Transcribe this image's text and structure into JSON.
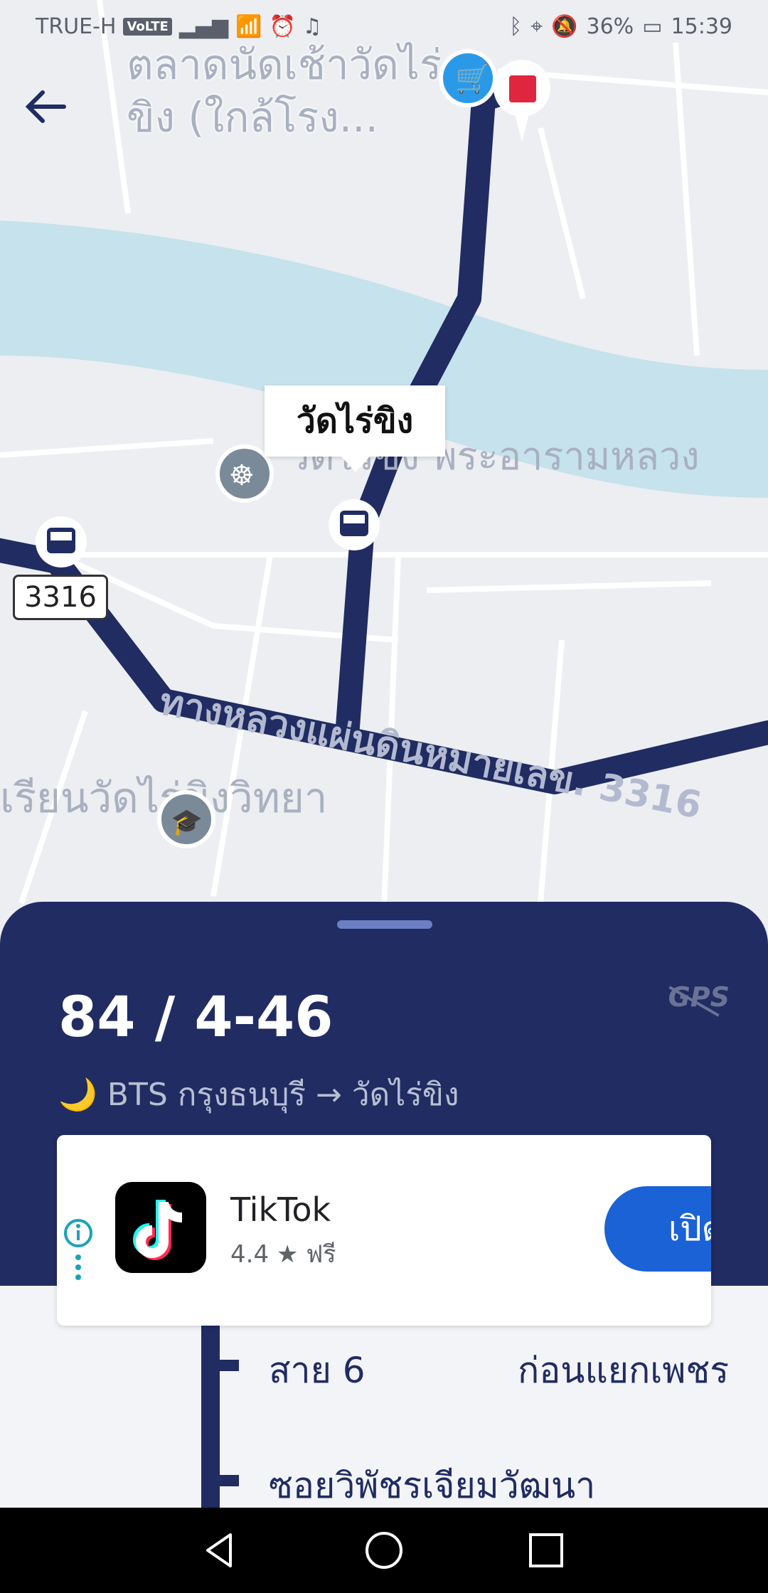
{
  "status_bar": {
    "carrier": "TRUE-H",
    "volte": "VoLTE",
    "battery": "36%",
    "time": "15:39"
  },
  "map": {
    "title": "ตลาดนัดเช้าวัดไร่ขิง (ใกล้โรง...",
    "selected_stop_label": "วัดไร่ขิง",
    "poi_temple": "วัดไร่ขิง พระอารามหลวง",
    "poi_school": "เรียนวัดไร่ขิงวิทยา",
    "road_name": "ทางหลวงแผ่นดินหมายเลข. 3316",
    "road_shield": "3316"
  },
  "sheet": {
    "route_number": "84 / 4-46",
    "route_icon": "moon-icon",
    "route_path": "BTS กรุงธนบุรี → วัดไร่ขิง",
    "gps_status": "GPS"
  },
  "ad": {
    "app_name": "TikTok",
    "rating": "4.4",
    "price": "ฟรี",
    "button_label": "เปิด"
  },
  "stops": [
    {
      "name": "สาย 6",
      "detail": "ก่อนแยกเพชร"
    },
    {
      "name": "ซอยวิพัชรเจียมวัฒนา"
    }
  ],
  "colors": {
    "route": "#202c62",
    "accent": "#1a62d6",
    "river": "#c6e2ec"
  }
}
